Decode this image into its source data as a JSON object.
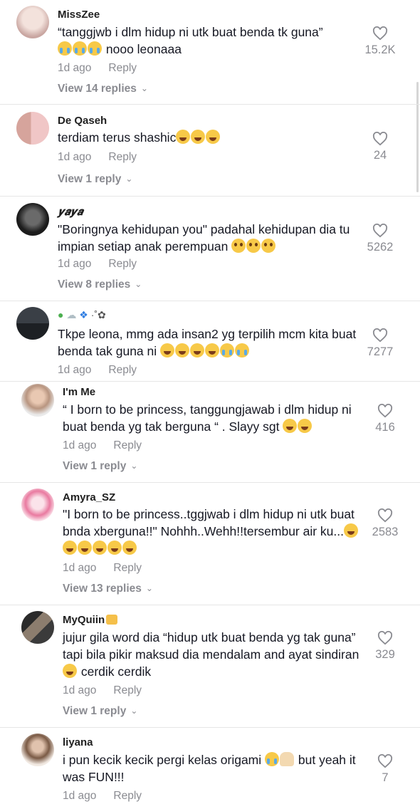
{
  "comments": [
    {
      "username": "MissZee",
      "text": "“tanggjwb i dlm hidup ni utk buat benda tk guna”",
      "emoji_suffix": "nooo leonaaa",
      "time": "1d ago",
      "reply": "Reply",
      "view": "View 14 replies",
      "likes": "15.2K"
    },
    {
      "username": "De Qaseh",
      "text": "terdiam terus shashic",
      "time": "1d ago",
      "reply": "Reply",
      "view": "View 1 reply",
      "likes": "24"
    },
    {
      "username": "𝒚𝒂𝒚𝒂",
      "text": "\"Boringnya kehidupan you\" padahal kehidupan dia tu impian setiap anak perempuan",
      "time": "1d ago",
      "reply": "Reply",
      "view": "View 8 replies",
      "likes": "5262"
    },
    {
      "username": "",
      "text": "Tkpe leona, mmg ada insan2 yg terpilih mcm kita buat benda tak guna ni",
      "time": "1d ago",
      "reply": "Reply",
      "likes": "7277"
    },
    {
      "username": "I'm Me",
      "text": "“ I born to be princess, tanggungjawab i dlm hidup ni buat benda yg tak berguna “ . Slayy sgt",
      "time": "1d ago",
      "reply": "Reply",
      "view": "View 1 reply",
      "likes": "416"
    },
    {
      "username": "Amyra_SZ",
      "text": "\"I born to be princess..tggjwab i dlm hidup ni utk buat bnda xberguna!!\" Nohhh..Wehh!!tersembur air ku...",
      "time": "1d ago",
      "reply": "Reply",
      "view": "View 13 replies",
      "likes": "2583"
    },
    {
      "username": "MyQuiin",
      "text": "jujur gila word dia “hidup utk buat benda yg tak guna” tapi bila pikir maksud dia mendalam and ayat sindiran",
      "text_tail": "cerdik cerdik",
      "time": "1d ago",
      "reply": "Reply",
      "view": "View 1 reply",
      "likes": "329"
    },
    {
      "username": "liyana",
      "text": "i pun kecik kecik pergi kelas origami",
      "text_tail": "but yeah it was FUN!!!",
      "time": "1d ago",
      "reply": "Reply",
      "likes": "7"
    }
  ],
  "icons": {
    "like": "heart-outline-icon",
    "chevron": "chevron-down-icon"
  },
  "colors": {
    "meta": "#8a8b91",
    "text": "#161823"
  }
}
